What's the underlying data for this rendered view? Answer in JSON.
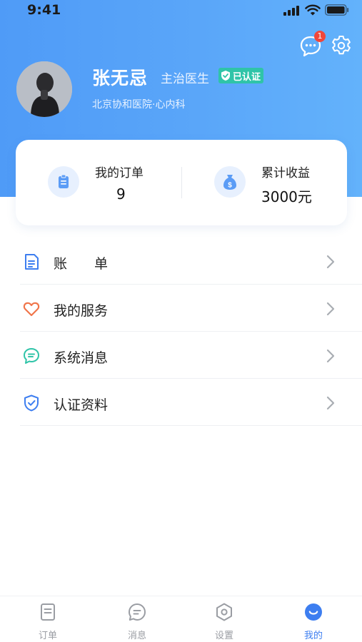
{
  "status_bar": {
    "time": "9:41"
  },
  "header": {
    "message_badge": "1",
    "colors": {
      "gradient_start": "#4f9bf7",
      "gradient_end": "#63b2fb"
    }
  },
  "profile": {
    "name": "张无忌",
    "title": "主治医生",
    "verified_label": "已认证",
    "hospital": "北京协和医院·心内科"
  },
  "stats": {
    "orders": {
      "label": "我的订单",
      "value": "9",
      "icon": "clipboard-icon"
    },
    "earnings": {
      "label": "累计收益",
      "value": "3000元",
      "icon": "money-bag-icon"
    }
  },
  "menu": [
    {
      "label": "账　　单",
      "icon": "bill-document-icon",
      "color": "#3d7ef0"
    },
    {
      "label": "我的服务",
      "icon": "heart-icon",
      "color": "#f0754a"
    },
    {
      "label": "系统消息",
      "icon": "chat-bubble-icon",
      "color": "#2fc4a8"
    },
    {
      "label": "认证资料",
      "icon": "shield-check-icon",
      "color": "#3d7ef0"
    }
  ],
  "tabbar": [
    {
      "label": "订单",
      "icon": "order-document-icon",
      "active": false
    },
    {
      "label": "消息",
      "icon": "message-icon",
      "active": false
    },
    {
      "label": "设置",
      "icon": "settings-hexagon-icon",
      "active": false
    },
    {
      "label": "我的",
      "icon": "smile-icon",
      "active": true
    }
  ],
  "accent_color": "#3d7ef0"
}
